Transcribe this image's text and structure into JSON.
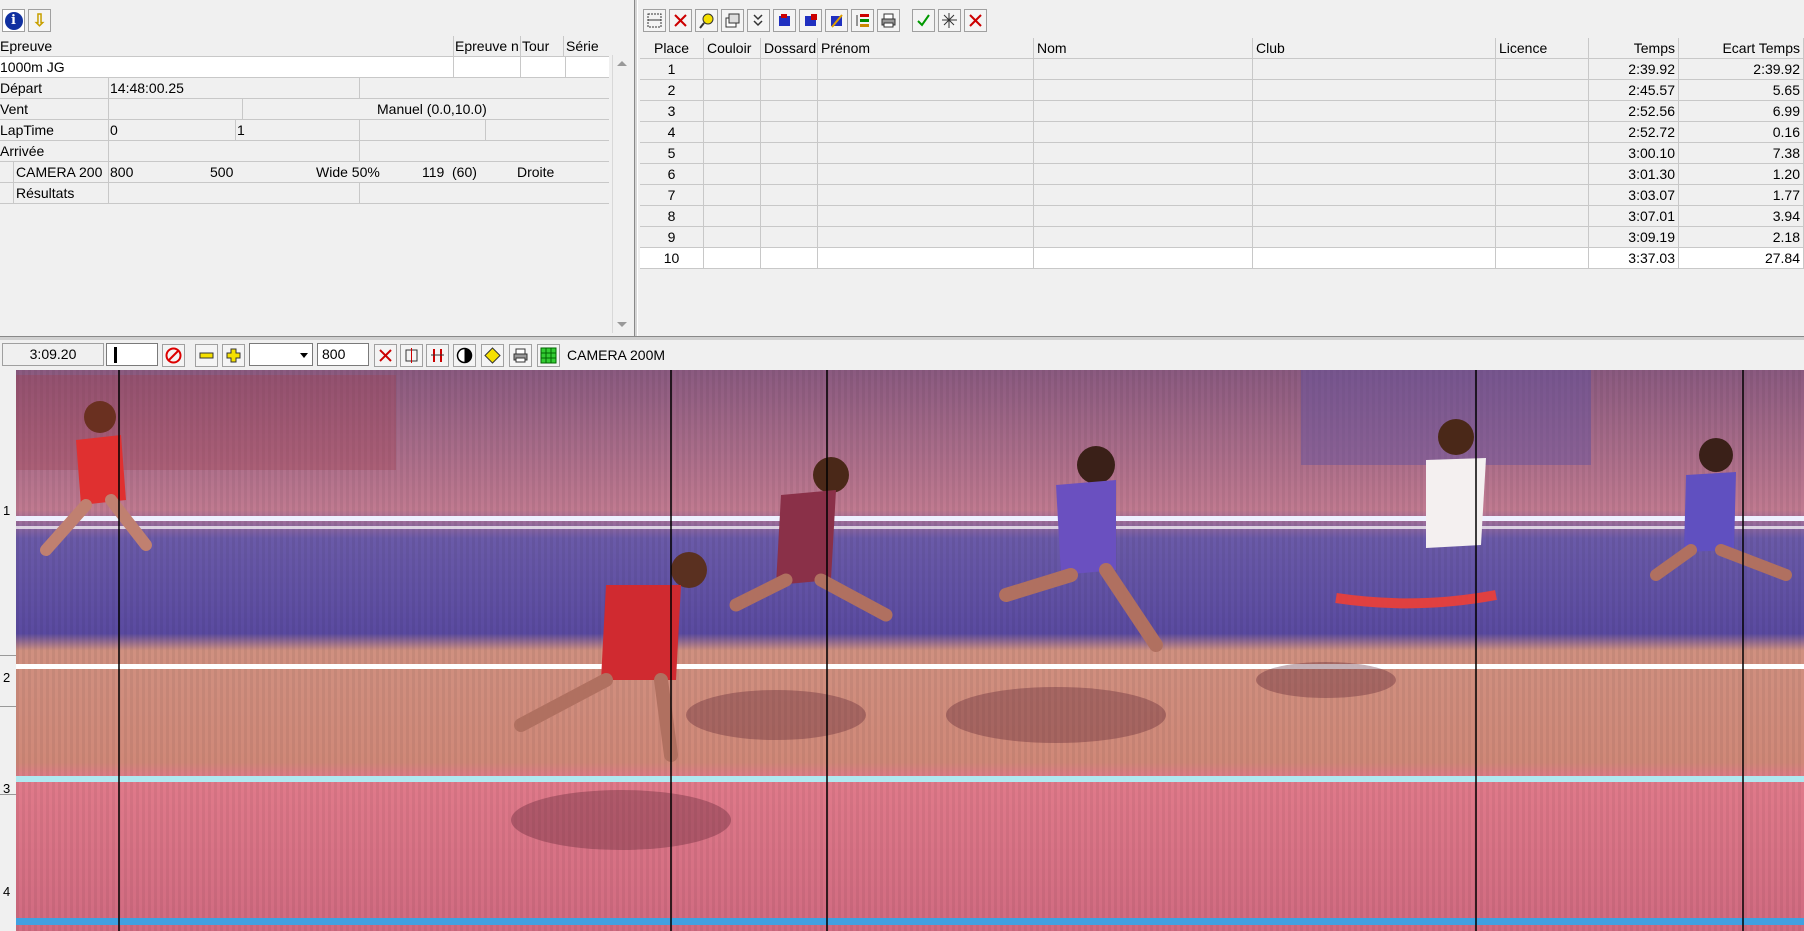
{
  "top_left_toolbar": {
    "info_icon": "i",
    "download_icon": "⇩"
  },
  "event": {
    "headers": {
      "epreuve": "Epreuve",
      "epreuve_n": "Epreuve n",
      "tour": "Tour",
      "serie": "Série"
    },
    "name": "1000m JG",
    "depart_label": "Départ",
    "depart_value": "14:48:00.25",
    "vent_label": "Vent",
    "vent_value": "Manuel (0.0,10.0)",
    "laptime_label": "LapTime",
    "laptime_a": "0",
    "laptime_b": "1",
    "arrivee_label": "Arrivée",
    "camera": {
      "name": "CAMERA 200",
      "v1": "800",
      "v2": "500",
      "wide": "Wide 50%",
      "v3": "119",
      "v4": "(60)",
      "side": "Droite"
    },
    "resultats_label": "Résultats"
  },
  "results_table": {
    "headers": [
      "Place",
      "Couloir",
      "Dossard",
      "Prénom",
      "Nom",
      "Club",
      "Licence",
      "Temps",
      "Ecart Temps"
    ],
    "rows": [
      {
        "place": "1",
        "temps": "2:39.92",
        "ecart": "2:39.92"
      },
      {
        "place": "2",
        "temps": "2:45.57",
        "ecart": "5.65"
      },
      {
        "place": "3",
        "temps": "2:52.56",
        "ecart": "6.99"
      },
      {
        "place": "4",
        "temps": "2:52.72",
        "ecart": "0.16"
      },
      {
        "place": "5",
        "temps": "3:00.10",
        "ecart": "7.38"
      },
      {
        "place": "6",
        "temps": "3:01.30",
        "ecart": "1.20"
      },
      {
        "place": "7",
        "temps": "3:03.07",
        "ecart": "1.77"
      },
      {
        "place": "8",
        "temps": "3:07.01",
        "ecart": "3.94"
      },
      {
        "place": "9",
        "temps": "3:09.19",
        "ecart": "2.18"
      },
      {
        "place": "10",
        "temps": "3:37.03",
        "ecart": "27.84"
      }
    ]
  },
  "photo_toolbar": {
    "time": "3:09.20",
    "zoom_value": "800",
    "camera_label": "CAMERA 200M"
  },
  "lane_numbers": [
    "1",
    "2",
    "3",
    "4"
  ]
}
